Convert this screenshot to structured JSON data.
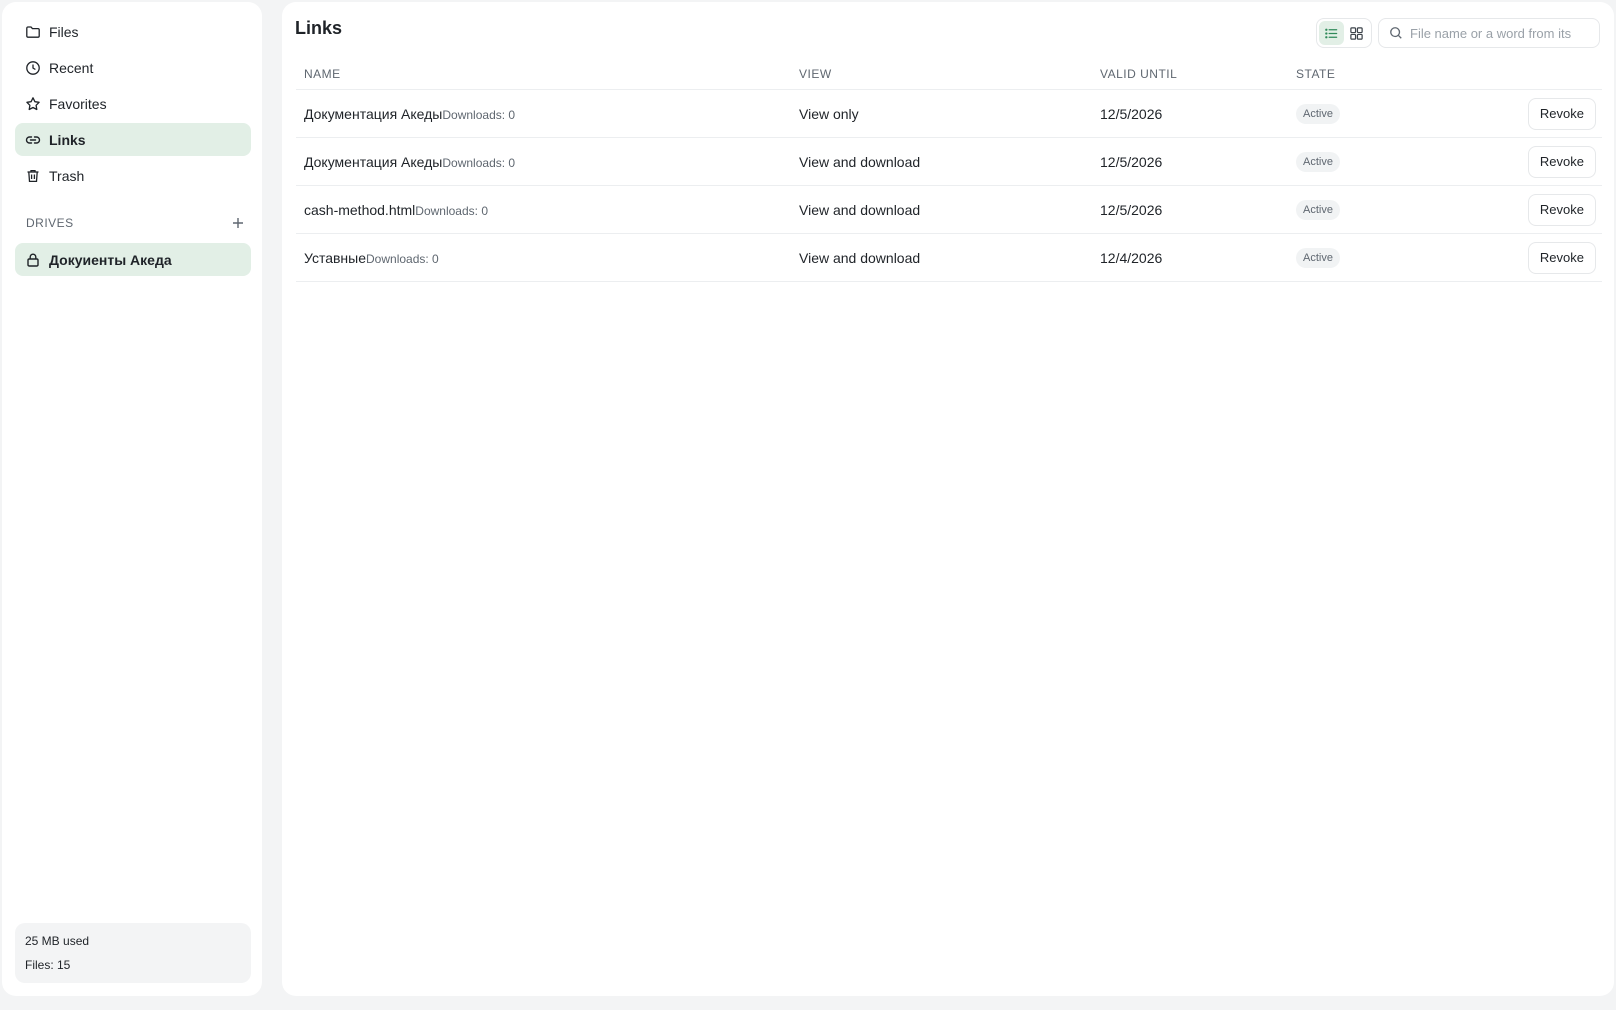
{
  "sidebar": {
    "nav": [
      {
        "label": "Files",
        "icon": "folder-icon"
      },
      {
        "label": "Recent",
        "icon": "clock-icon"
      },
      {
        "label": "Favorites",
        "icon": "star-icon"
      },
      {
        "label": "Links",
        "icon": "link-icon",
        "active": true
      },
      {
        "label": "Trash",
        "icon": "trash-icon"
      }
    ],
    "drives_label": "DRIVES",
    "drive": {
      "label": "Докуиенты Акеда",
      "icon": "lock-icon"
    },
    "usage": {
      "used": "25 MB used",
      "files": "Files: 15"
    }
  },
  "main": {
    "title": "Links",
    "search_placeholder": "File name or a word from its",
    "columns": {
      "name": "NAME",
      "view": "VIEW",
      "valid_until": "VALID UNTIL",
      "state": "STATE"
    },
    "rows": [
      {
        "name": "Документация Акеды",
        "downloads": "Downloads: 0",
        "view": "View only",
        "valid_until": "12/5/2026",
        "state": "Active",
        "action": "Revoke"
      },
      {
        "name": "Документация Акеды",
        "downloads": "Downloads: 0",
        "view": "View and download",
        "valid_until": "12/5/2026",
        "state": "Active",
        "action": "Revoke"
      },
      {
        "name": "cash-method.html",
        "downloads": "Downloads: 0",
        "view": "View and download",
        "valid_until": "12/5/2026",
        "state": "Active",
        "action": "Revoke"
      },
      {
        "name": "Уставные",
        "downloads": "Downloads: 0",
        "view": "View and download",
        "valid_until": "12/4/2026",
        "state": "Active",
        "action": "Revoke"
      }
    ]
  },
  "colors": {
    "accent_bg": "#e2efe6",
    "background": "#f3f4f5",
    "panel": "#ffffff"
  }
}
